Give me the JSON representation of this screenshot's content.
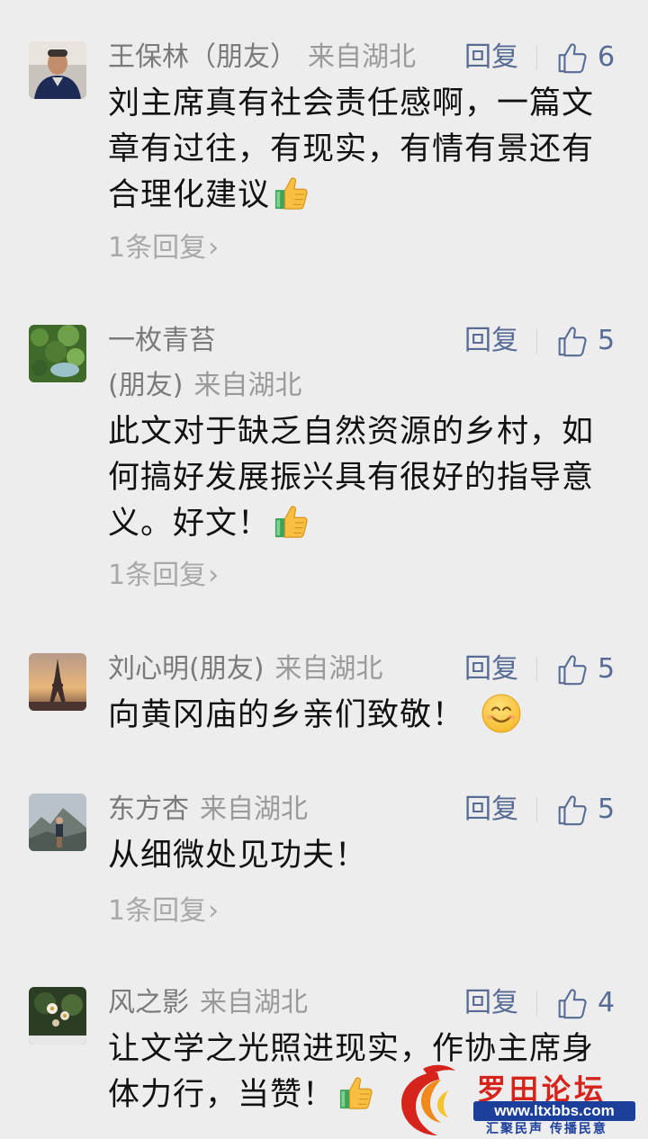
{
  "comments": [
    {
      "name": "王保林（朋友）",
      "name_line2": "",
      "from": "来自湖北",
      "reply": "回复",
      "likes": "6",
      "text": "刘主席真有社会责任感啊，一篇文章有过往，有现实，有情有景还有合理化建议",
      "replies": "1条回复"
    },
    {
      "name": "一枚青苔",
      "name_line2": "(朋友)",
      "from": "来自湖北",
      "reply": "回复",
      "likes": "5",
      "text": "此文对于缺乏自然资源的乡村，如何搞好发展振兴具有很好的指导意义。好文！",
      "replies": "1条回复"
    },
    {
      "name": "刘心明(朋友)",
      "name_line2": "",
      "from": "来自湖北",
      "reply": "回复",
      "likes": "5",
      "text": "向黄冈庙的乡亲们致敬！",
      "replies": ""
    },
    {
      "name": "东方杏",
      "name_line2": "",
      "from": "来自湖北",
      "reply": "回复",
      "likes": "5",
      "text": "从细微处见功夫！",
      "replies": "1条回复"
    },
    {
      "name": "风之影",
      "name_line2": "",
      "from": "来自湖北",
      "reply": "回复",
      "likes": "4",
      "text": "让文学之光照进现实，作协主席身体力行，当赞！",
      "replies": ""
    }
  ],
  "watermark": {
    "title": "罗田论坛",
    "url": "www.ltxbbs.com",
    "slogan": "汇聚民声 传播民意"
  },
  "colors": {
    "background": "#ededed",
    "link": "#576b95",
    "meta": "#9a9a9a"
  }
}
